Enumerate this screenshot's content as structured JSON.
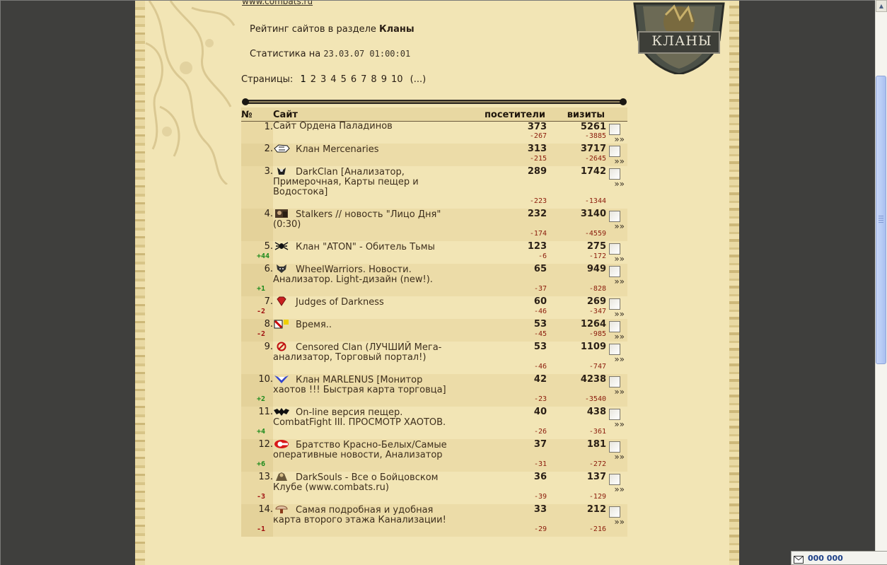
{
  "header": {
    "top_link": "www.combats.ru",
    "heading_prefix": "Рейтинг сайтов в разделе",
    "heading_section": "Кланы",
    "stats_label": "Статистика на",
    "stats_datetime": "23.03.07 01:00:01",
    "emblem_text": "КЛАНЫ"
  },
  "pagination": {
    "label": "Страницы:",
    "pages": [
      "1",
      "2",
      "3",
      "4",
      "5",
      "6",
      "7",
      "8",
      "9",
      "10"
    ],
    "more": "(...)"
  },
  "table": {
    "headers": {
      "num": "№",
      "site": "Сайт",
      "visitors": "посетители",
      "hits": "визиты"
    },
    "arrow": "»»",
    "rows": [
      {
        "num": "1.",
        "icon": "none",
        "title": "Сайт Ордена Паладинов",
        "visitors": "373",
        "hits": "5261",
        "d_visitors": "-267",
        "d_hits": "-3885",
        "rank_change": "",
        "rank_dir": ""
      },
      {
        "num": "2.",
        "icon": "mercenaries-icon",
        "title": "Клан Mercenaries",
        "visitors": "313",
        "hits": "3717",
        "d_visitors": "-215",
        "d_hits": "-2645",
        "rank_change": "",
        "rank_dir": ""
      },
      {
        "num": "3.",
        "icon": "darkclan-icon",
        "title": "DarkClan [Анализатор, Примерочная, Карты пещер и Водостока]",
        "visitors": "289",
        "hits": "1742",
        "d_visitors": "-223",
        "d_hits": "-1344",
        "rank_change": "",
        "rank_dir": ""
      },
      {
        "num": "4.",
        "icon": "stalkers-icon",
        "title": "Stalkers // новость \"Лицо Дня\" (0:30)",
        "visitors": "232",
        "hits": "3140",
        "d_visitors": "-174",
        "d_hits": "-4559",
        "rank_change": "",
        "rank_dir": ""
      },
      {
        "num": "5.",
        "icon": "spider-icon",
        "title": "Клан \"ATON\" - Обитель Тьмы",
        "visitors": "123",
        "hits": "275",
        "d_visitors": "-6",
        "d_hits": "-172",
        "rank_change": "+44",
        "rank_dir": "up"
      },
      {
        "num": "6.",
        "icon": "wolf-icon",
        "title": "WheelWarriors. Новости. Анализатор. Light-дизайн (new!).",
        "visitors": "65",
        "hits": "949",
        "d_visitors": "-37",
        "d_hits": "-828",
        "rank_change": "+1",
        "rank_dir": "up"
      },
      {
        "num": "7.",
        "icon": "gem-icon",
        "title": "Judges of Darkness",
        "visitors": "60",
        "hits": "269",
        "d_visitors": "-46",
        "d_hits": "-347",
        "rank_change": "-2",
        "rank_dir": "down"
      },
      {
        "num": "8.",
        "icon": "cards-icon",
        "title": "Время..",
        "visitors": "53",
        "hits": "1264",
        "d_visitors": "-45",
        "d_hits": "-985",
        "rank_change": "-2",
        "rank_dir": "down"
      },
      {
        "num": "9.",
        "icon": "censored-icon",
        "title": "Censored Clan (ЛУЧШИЙ Мега-анализатор, Торговый портал!)",
        "visitors": "53",
        "hits": "1109",
        "d_visitors": "-46",
        "d_hits": "-747",
        "rank_change": "",
        "rank_dir": ""
      },
      {
        "num": "10.",
        "icon": "triangle-icon",
        "title": "Клан MARLENUS [Монитор хаотов !!! Быстрая карта торговца]",
        "visitors": "42",
        "hits": "4238",
        "d_visitors": "-23",
        "d_hits": "-3540",
        "rank_change": "+2",
        "rank_dir": "up"
      },
      {
        "num": "11.",
        "icon": "bat-icon",
        "title": "On-line версия пещер. CombatFight III. ПРОСМОТР ХАОТОВ.",
        "visitors": "40",
        "hits": "438",
        "d_visitors": "-26",
        "d_hits": "-361",
        "rank_change": "+4",
        "rank_dir": "up"
      },
      {
        "num": "12.",
        "icon": "red-white-icon",
        "title": "Братство Красно-Белых/Самые оперативные новости, Анализатор",
        "visitors": "37",
        "hits": "181",
        "d_visitors": "-31",
        "d_hits": "-272",
        "rank_change": "+6",
        "rank_dir": "up"
      },
      {
        "num": "13.",
        "icon": "darksouls-icon",
        "title": "DarkSouls - Все о Бойцовском Клубе (www.combats.ru)",
        "visitors": "36",
        "hits": "137",
        "d_visitors": "-39",
        "d_hits": "-129",
        "rank_change": "-3",
        "rank_dir": "down"
      },
      {
        "num": "14.",
        "icon": "mushroom-icon",
        "title": "Самая подробная и удобная карта второго этажа Канализации!",
        "visitors": "33",
        "hits": "212",
        "d_visitors": "-29",
        "d_hits": "-216",
        "rank_change": "-1",
        "rank_dir": "down"
      }
    ]
  },
  "counter": {
    "count": "000 000",
    "icon": "envelope-icon"
  },
  "colors": {
    "parchment": "#f2e5b5",
    "background": "#3f3f3d",
    "negative": "#8a1a0a",
    "positive": "#1b8a1b",
    "scroll_thumb": "#b9cdf6"
  }
}
